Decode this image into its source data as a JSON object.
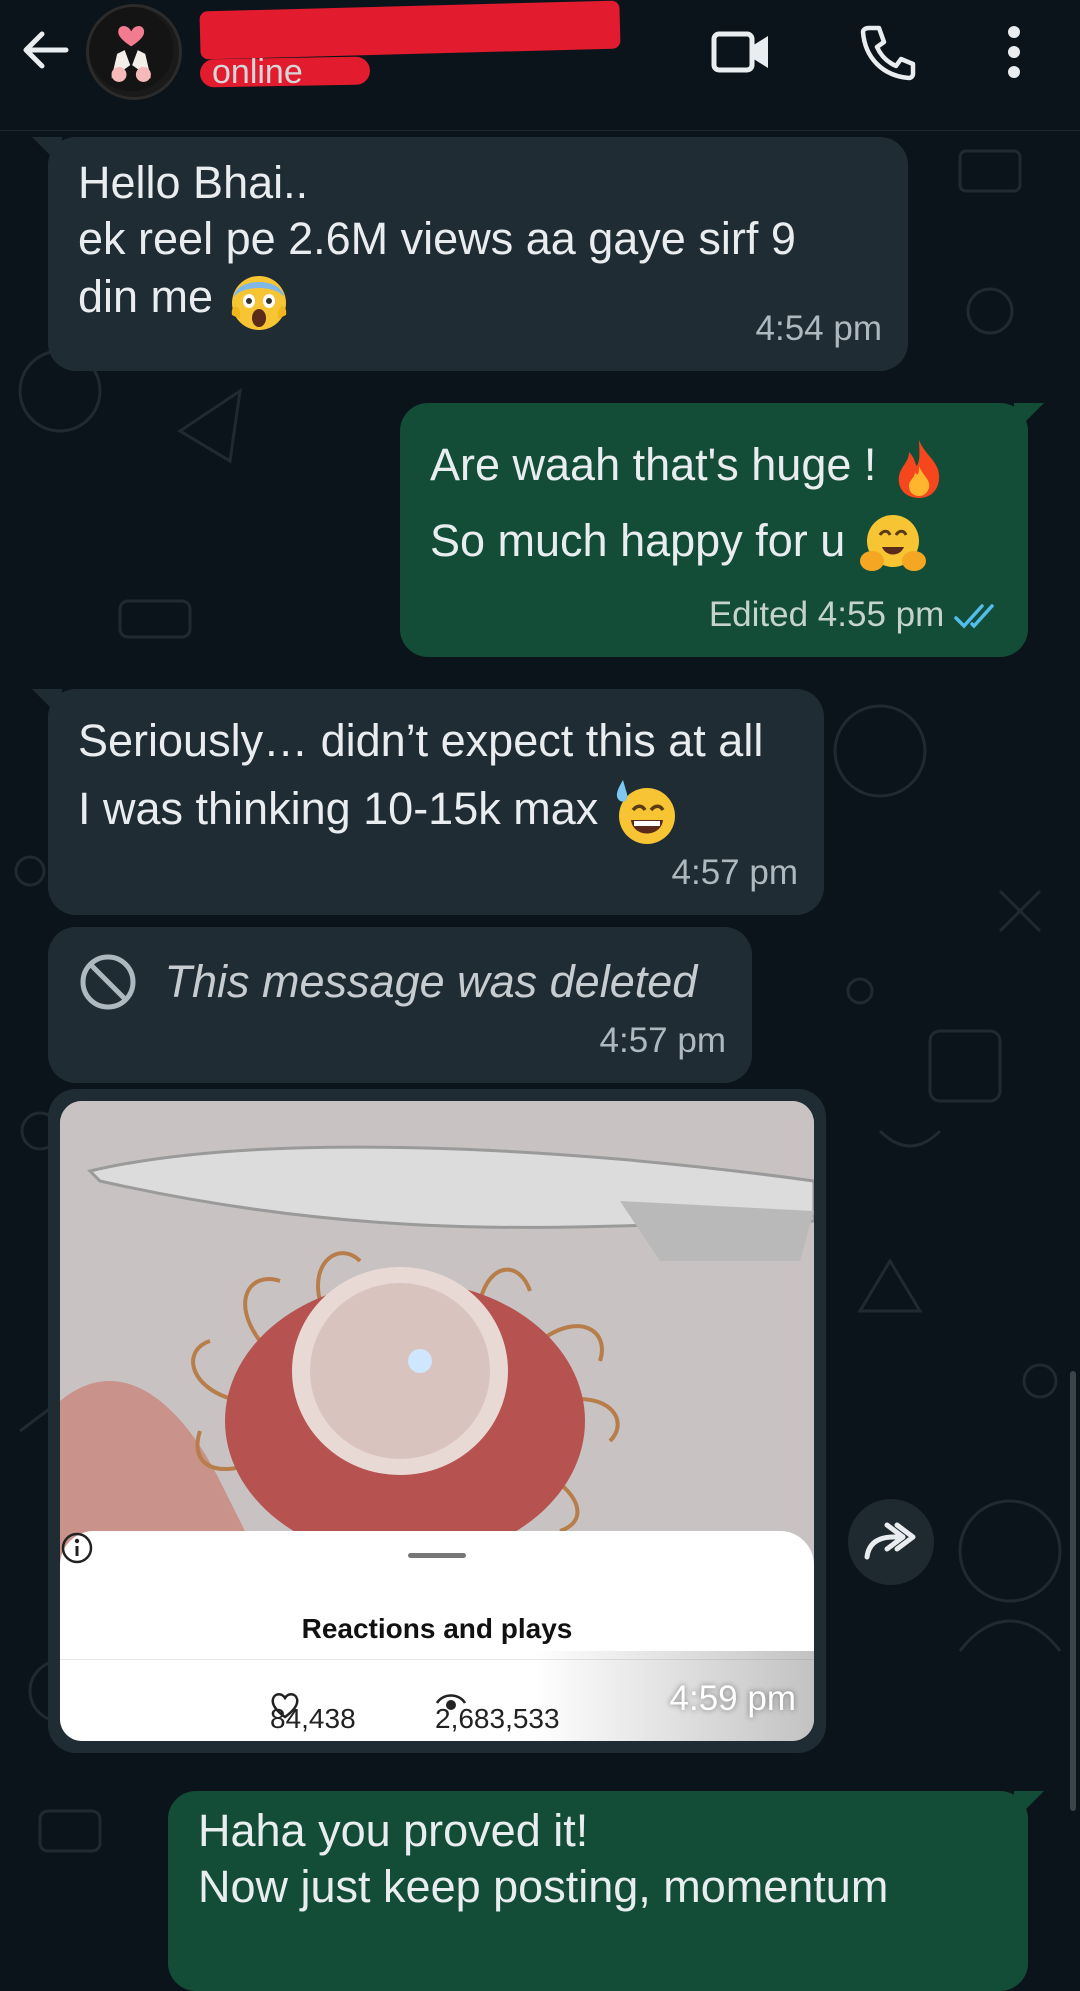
{
  "header": {
    "contact_name": "",
    "status": "online",
    "icons": [
      "back-arrow-icon",
      "avatar",
      "video-call-icon",
      "phone-icon",
      "more-vert-icon"
    ]
  },
  "messages": [
    {
      "direction": "incoming",
      "lines": [
        "Hello Bhai..",
        "ek reel pe 2.6M views aa gaye sirf 9",
        "din me"
      ],
      "emoji": "face-screaming-in-fear",
      "time": "4:54 pm"
    },
    {
      "direction": "outgoing",
      "lines": [
        "Are waah that's huge !",
        "So much happy for u"
      ],
      "emoji": [
        "fire",
        "hugging-face"
      ],
      "edited_label": "Edited",
      "time": "4:55 pm",
      "status": "read"
    },
    {
      "direction": "incoming",
      "lines": [
        "Seriously… didn’t expect this at all",
        "I was thinking 10-15k max"
      ],
      "emoji": "grinning-face-with-sweat",
      "time": "4:57 pm"
    },
    {
      "direction": "incoming",
      "deleted_text": "This message was deleted",
      "time": "4:57 pm"
    },
    {
      "direction": "incoming",
      "type": "image",
      "sheet_title": "Reactions and plays",
      "likes": "84,438",
      "plays": "2,683,533",
      "faded_count": "84.4K",
      "time": "4:59 pm"
    },
    {
      "direction": "outgoing",
      "lines": [
        "Haha you proved it!",
        "Now just keep posting, momentum"
      ]
    }
  ],
  "colors": {
    "background": "#0b141a",
    "incoming_bubble": "#202c33",
    "outgoing_bubble": "#144d37",
    "read_tick": "#53bdeb",
    "redaction": "#e21b2e"
  }
}
